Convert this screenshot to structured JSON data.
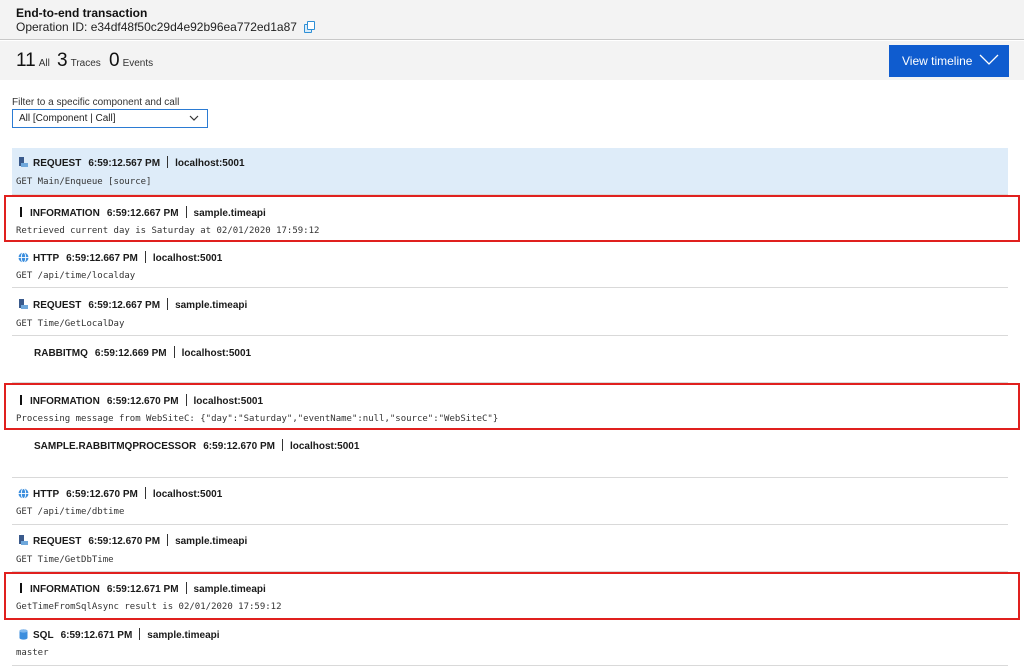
{
  "header": {
    "title": "End-to-end transaction",
    "operation_id": "Operation ID: e34df48f50c29d4e92b96ea772ed1a87"
  },
  "counts": {
    "all_num": "11",
    "all_label": "All",
    "traces_num": "3",
    "traces_label": "Traces",
    "events_num": "0",
    "events_label": "Events"
  },
  "view_timeline_label": "View timeline",
  "filter": {
    "label": "Filter to a specific component and call",
    "value": "All [Component | Call]"
  },
  "colors": {
    "accent": "#0f5ccf",
    "highlight": "#e0201e",
    "selected_row": "#deecf9"
  },
  "rows": [
    {
      "type": "REQUEST",
      "time": "6:59:12.567 PM",
      "component": "localhost:5001",
      "detail": "GET Main/Enqueue [source]",
      "icon": "request-icon"
    },
    {
      "type": "INFORMATION",
      "time": "6:59:12.667 PM",
      "component": "sample.timeapi",
      "detail": "Retrieved current day is Saturday at 02/01/2020 17:59:12",
      "icon": "trace-bar-icon"
    },
    {
      "type": "HTTP",
      "time": "6:59:12.667 PM",
      "component": "localhost:5001",
      "detail": "GET /api/time/localday",
      "icon": "http-globe-icon"
    },
    {
      "type": "REQUEST",
      "time": "6:59:12.667 PM",
      "component": "sample.timeapi",
      "detail": "GET Time/GetLocalDay",
      "icon": "request-icon"
    },
    {
      "type": "RABBITMQ",
      "time": "6:59:12.669 PM",
      "component": "localhost:5001",
      "detail": "",
      "icon": ""
    },
    {
      "type": "INFORMATION",
      "time": "6:59:12.670 PM",
      "component": "localhost:5001",
      "detail": "Processing message from WebSiteC: {\"day\":\"Saturday\",\"eventName\":null,\"source\":\"WebSiteC\"}",
      "icon": "trace-bar-icon"
    },
    {
      "type": "SAMPLE.RABBITMQPROCESSOR",
      "time": "6:59:12.670 PM",
      "component": "localhost:5001",
      "detail": "",
      "icon": ""
    },
    {
      "type": "HTTP",
      "time": "6:59:12.670 PM",
      "component": "localhost:5001",
      "detail": "GET /api/time/dbtime",
      "icon": "http-globe-icon"
    },
    {
      "type": "REQUEST",
      "time": "6:59:12.670 PM",
      "component": "sample.timeapi",
      "detail": "GET Time/GetDbTime",
      "icon": "request-icon"
    },
    {
      "type": "INFORMATION",
      "time": "6:59:12.671 PM",
      "component": "sample.timeapi",
      "detail": "GetTimeFromSqlAsync result is 02/01/2020 17:59:12",
      "icon": "trace-bar-icon"
    },
    {
      "type": "SQL",
      "time": "6:59:12.671 PM",
      "component": "sample.timeapi",
      "detail": "master",
      "icon": "sql-database-icon"
    }
  ]
}
